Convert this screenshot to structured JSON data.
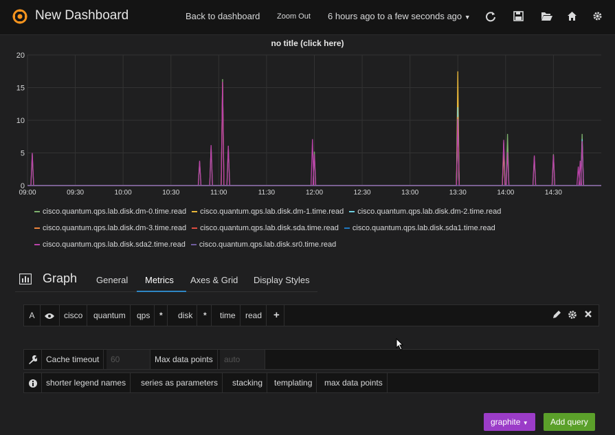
{
  "topnav": {
    "title": "New Dashboard",
    "back_label": "Back to dashboard",
    "zoom_label": "Zoom Out",
    "time_range": "6 hours ago to a few seconds ago",
    "icons": [
      "refresh-icon",
      "save-icon",
      "folder-open-icon",
      "home-icon",
      "gear-icon"
    ]
  },
  "panel": {
    "title": "no title (click here)"
  },
  "chart_data": {
    "type": "line",
    "title": "no title (click here)",
    "xlabel": "",
    "ylabel": "",
    "x_ticks": [
      "09:00",
      "09:30",
      "10:00",
      "10:30",
      "11:00",
      "11:30",
      "12:00",
      "12:30",
      "13:00",
      "13:30",
      "14:00",
      "14:30"
    ],
    "y_ticks": [
      "0",
      "5",
      "10",
      "15",
      "20"
    ],
    "ylim": [
      0,
      20
    ],
    "xlim_hours": [
      9.0,
      15.0
    ],
    "grid": true,
    "legend_placement": "bottom",
    "series": [
      {
        "name": "cisco.quantum.qps.lab.disk.dm-0.time.read",
        "color": "#7eb26d",
        "peaks": [
          [
            9.05,
            4.8
          ],
          [
            10.8,
            3.6
          ],
          [
            10.92,
            6.0
          ],
          [
            11.04,
            16.3
          ],
          [
            11.1,
            6.0
          ],
          [
            12.0,
            5.2
          ],
          [
            13.5,
            12.1
          ],
          [
            13.98,
            6.6
          ],
          [
            14.02,
            7.9
          ],
          [
            14.3,
            4.4
          ],
          [
            14.5,
            4.8
          ],
          [
            14.8,
            7.9
          ]
        ]
      },
      {
        "name": "cisco.quantum.qps.lab.disk.dm-1.time.read",
        "color": "#eab839",
        "peaks": [
          [
            13.5,
            17.5
          ],
          [
            13.98,
            5.2
          ]
        ]
      },
      {
        "name": "cisco.quantum.qps.lab.disk.dm-2.time.read",
        "color": "#6ed0e0",
        "peaks": [
          [
            13.5,
            12.0
          ],
          [
            14.8,
            7.1
          ]
        ]
      },
      {
        "name": "cisco.quantum.qps.lab.disk.dm-3.time.read",
        "color": "#ef843c",
        "peaks": [
          [
            13.5,
            10.5
          ]
        ]
      },
      {
        "name": "cisco.quantum.qps.lab.disk.sda.time.read",
        "color": "#e24d42",
        "peaks": [
          [
            11.04,
            15.8
          ]
        ]
      },
      {
        "name": "cisco.quantum.qps.lab.disk.sda1.time.read",
        "color": "#1f78c1",
        "peaks": []
      },
      {
        "name": "cisco.quantum.qps.lab.disk.sda2.time.read",
        "color": "#ba43a9",
        "peaks": [
          [
            9.05,
            5.0
          ],
          [
            10.8,
            3.8
          ],
          [
            10.92,
            6.2
          ],
          [
            11.04,
            15.9
          ],
          [
            11.1,
            6.1
          ],
          [
            11.98,
            7.1
          ],
          [
            12.0,
            4.8
          ],
          [
            13.5,
            10.2
          ],
          [
            13.98,
            7.0
          ],
          [
            14.02,
            5.1
          ],
          [
            14.3,
            4.6
          ],
          [
            14.5,
            4.7
          ],
          [
            14.76,
            2.9
          ],
          [
            14.78,
            3.8
          ],
          [
            14.8,
            6.8
          ]
        ]
      },
      {
        "name": "cisco.quantum.qps.lab.disk.sr0.time.read",
        "color": "#705da0",
        "peaks": []
      }
    ]
  },
  "editor": {
    "panel_type": "Graph",
    "tabs": [
      "General",
      "Metrics",
      "Axes & Grid",
      "Display Styles"
    ],
    "active_tab": "Metrics"
  },
  "query": {
    "ref": "A",
    "segments": [
      "cisco",
      "quantum",
      "qps",
      "*",
      "disk",
      "*",
      "time",
      "read"
    ],
    "add_label": "+"
  },
  "options": {
    "cache_timeout_label": "Cache timeout",
    "cache_timeout_placeholder": "60",
    "max_points_label": "Max data points",
    "max_points_placeholder": "auto",
    "help_links": [
      "shorter legend names",
      "series as parameters",
      "stacking",
      "templating",
      "max data points"
    ]
  },
  "actions": {
    "datasource_label": "graphite",
    "add_query_label": "Add query"
  }
}
